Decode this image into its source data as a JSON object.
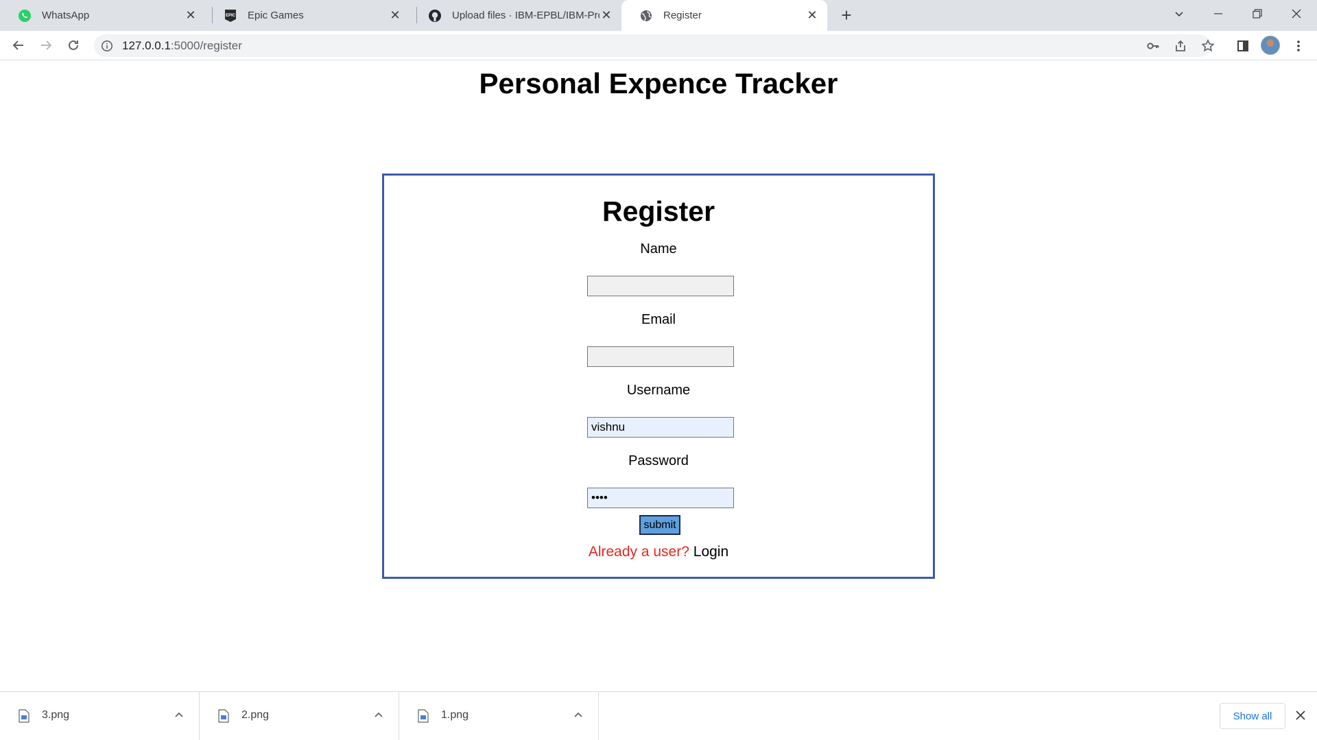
{
  "browser": {
    "tabs": [
      {
        "title": "WhatsApp",
        "icon": "whatsapp-icon",
        "active": false
      },
      {
        "title": "Epic Games",
        "icon": "epic-games-icon",
        "active": false
      },
      {
        "title": "Upload files · IBM-EPBL/IBM-Proj",
        "icon": "github-icon",
        "active": false
      },
      {
        "title": "Register",
        "icon": "globe-icon",
        "active": true
      }
    ],
    "url_host": "127.0.0.1",
    "url_path": ":5000/register"
  },
  "page": {
    "title": "Personal Expence Tracker"
  },
  "form": {
    "heading": "Register",
    "fields": [
      {
        "label": "Name",
        "value": ""
      },
      {
        "label": "Email",
        "value": ""
      },
      {
        "label": "Username",
        "value": "vishnu"
      },
      {
        "label": "Password",
        "value": "••••"
      }
    ],
    "submit_label": "submit",
    "login_prompt": "Already a user?",
    "login_link": "Login"
  },
  "downloads": {
    "items": [
      {
        "name": "3.png"
      },
      {
        "name": "2.png"
      },
      {
        "name": "1.png"
      }
    ],
    "show_all_label": "Show all"
  },
  "colors": {
    "card_border": "#3b5bab",
    "submit_bg": "#5e9fe0",
    "login_prompt": "#e8261e",
    "autofill_bg": "#e8f0fe"
  }
}
